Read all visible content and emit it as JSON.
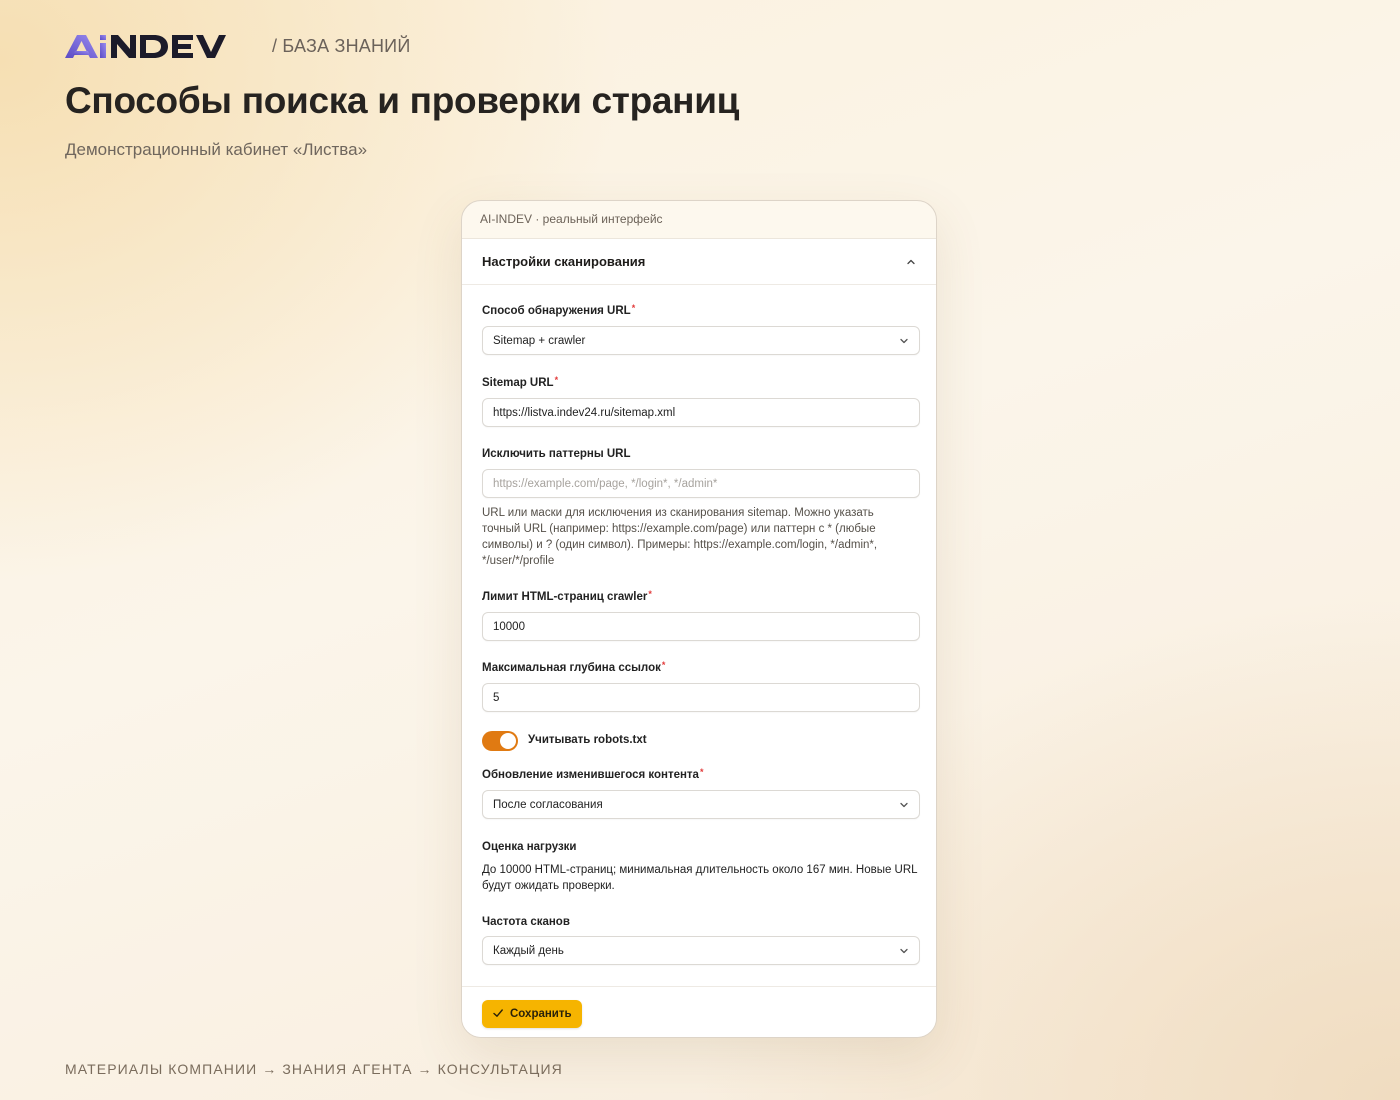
{
  "header": {
    "crumb": "/ БАЗА ЗНАНИЙ",
    "title": "Способы поиска и проверки страниц",
    "subtitle": "Демонстрационный кабинет «Листва»"
  },
  "card": {
    "caption": "AI-INDEV · реальный интерфейс",
    "panel_title": "Настройки сканирования",
    "fields": {
      "discovery": {
        "label": "Способ обнаружения URL",
        "value": "Sitemap + crawler"
      },
      "sitemap": {
        "label": "Sitemap URL",
        "value": "https://listva.indev24.ru/sitemap.xml"
      },
      "exclude": {
        "label": "Исключить паттерны URL",
        "placeholder": "https://example.com/page, */login*, */admin*",
        "hint": "URL или маски для исключения из сканирования sitemap. Можно указать точный URL (например: https://example.com/page) или паттерн с * (любые символы) и ? (один символ). Примеры: https://example.com/login, */admin*, */user/*/profile"
      },
      "page_limit": {
        "label": "Лимит HTML-страниц crawler",
        "value": "10000"
      },
      "max_depth": {
        "label": "Максимальная глубина ссылок",
        "value": "5"
      },
      "robots": {
        "label": "Учитывать robots.txt",
        "checked": true
      },
      "update": {
        "label": "Обновление изменившегося контента",
        "value": "После согласования"
      },
      "load": {
        "label": "Оценка нагрузки",
        "text": "До 10000 HTML-страниц; минимальная длительность около 167 мин. Новые URL будут ожидать проверки."
      },
      "frequency": {
        "label": "Частота сканов",
        "value": "Каждый день"
      }
    },
    "save_label": "Сохранить"
  },
  "footer": "МАТЕРИАЛЫ КОМПАНИИ → ЗНАНИЯ АГЕНТА → КОНСУЛЬТАЦИЯ",
  "colors": {
    "accent_orange": "#e07a12",
    "save_button": "#f6b400",
    "logo_purple": "#7a68d8",
    "required": "#e23b3b"
  }
}
